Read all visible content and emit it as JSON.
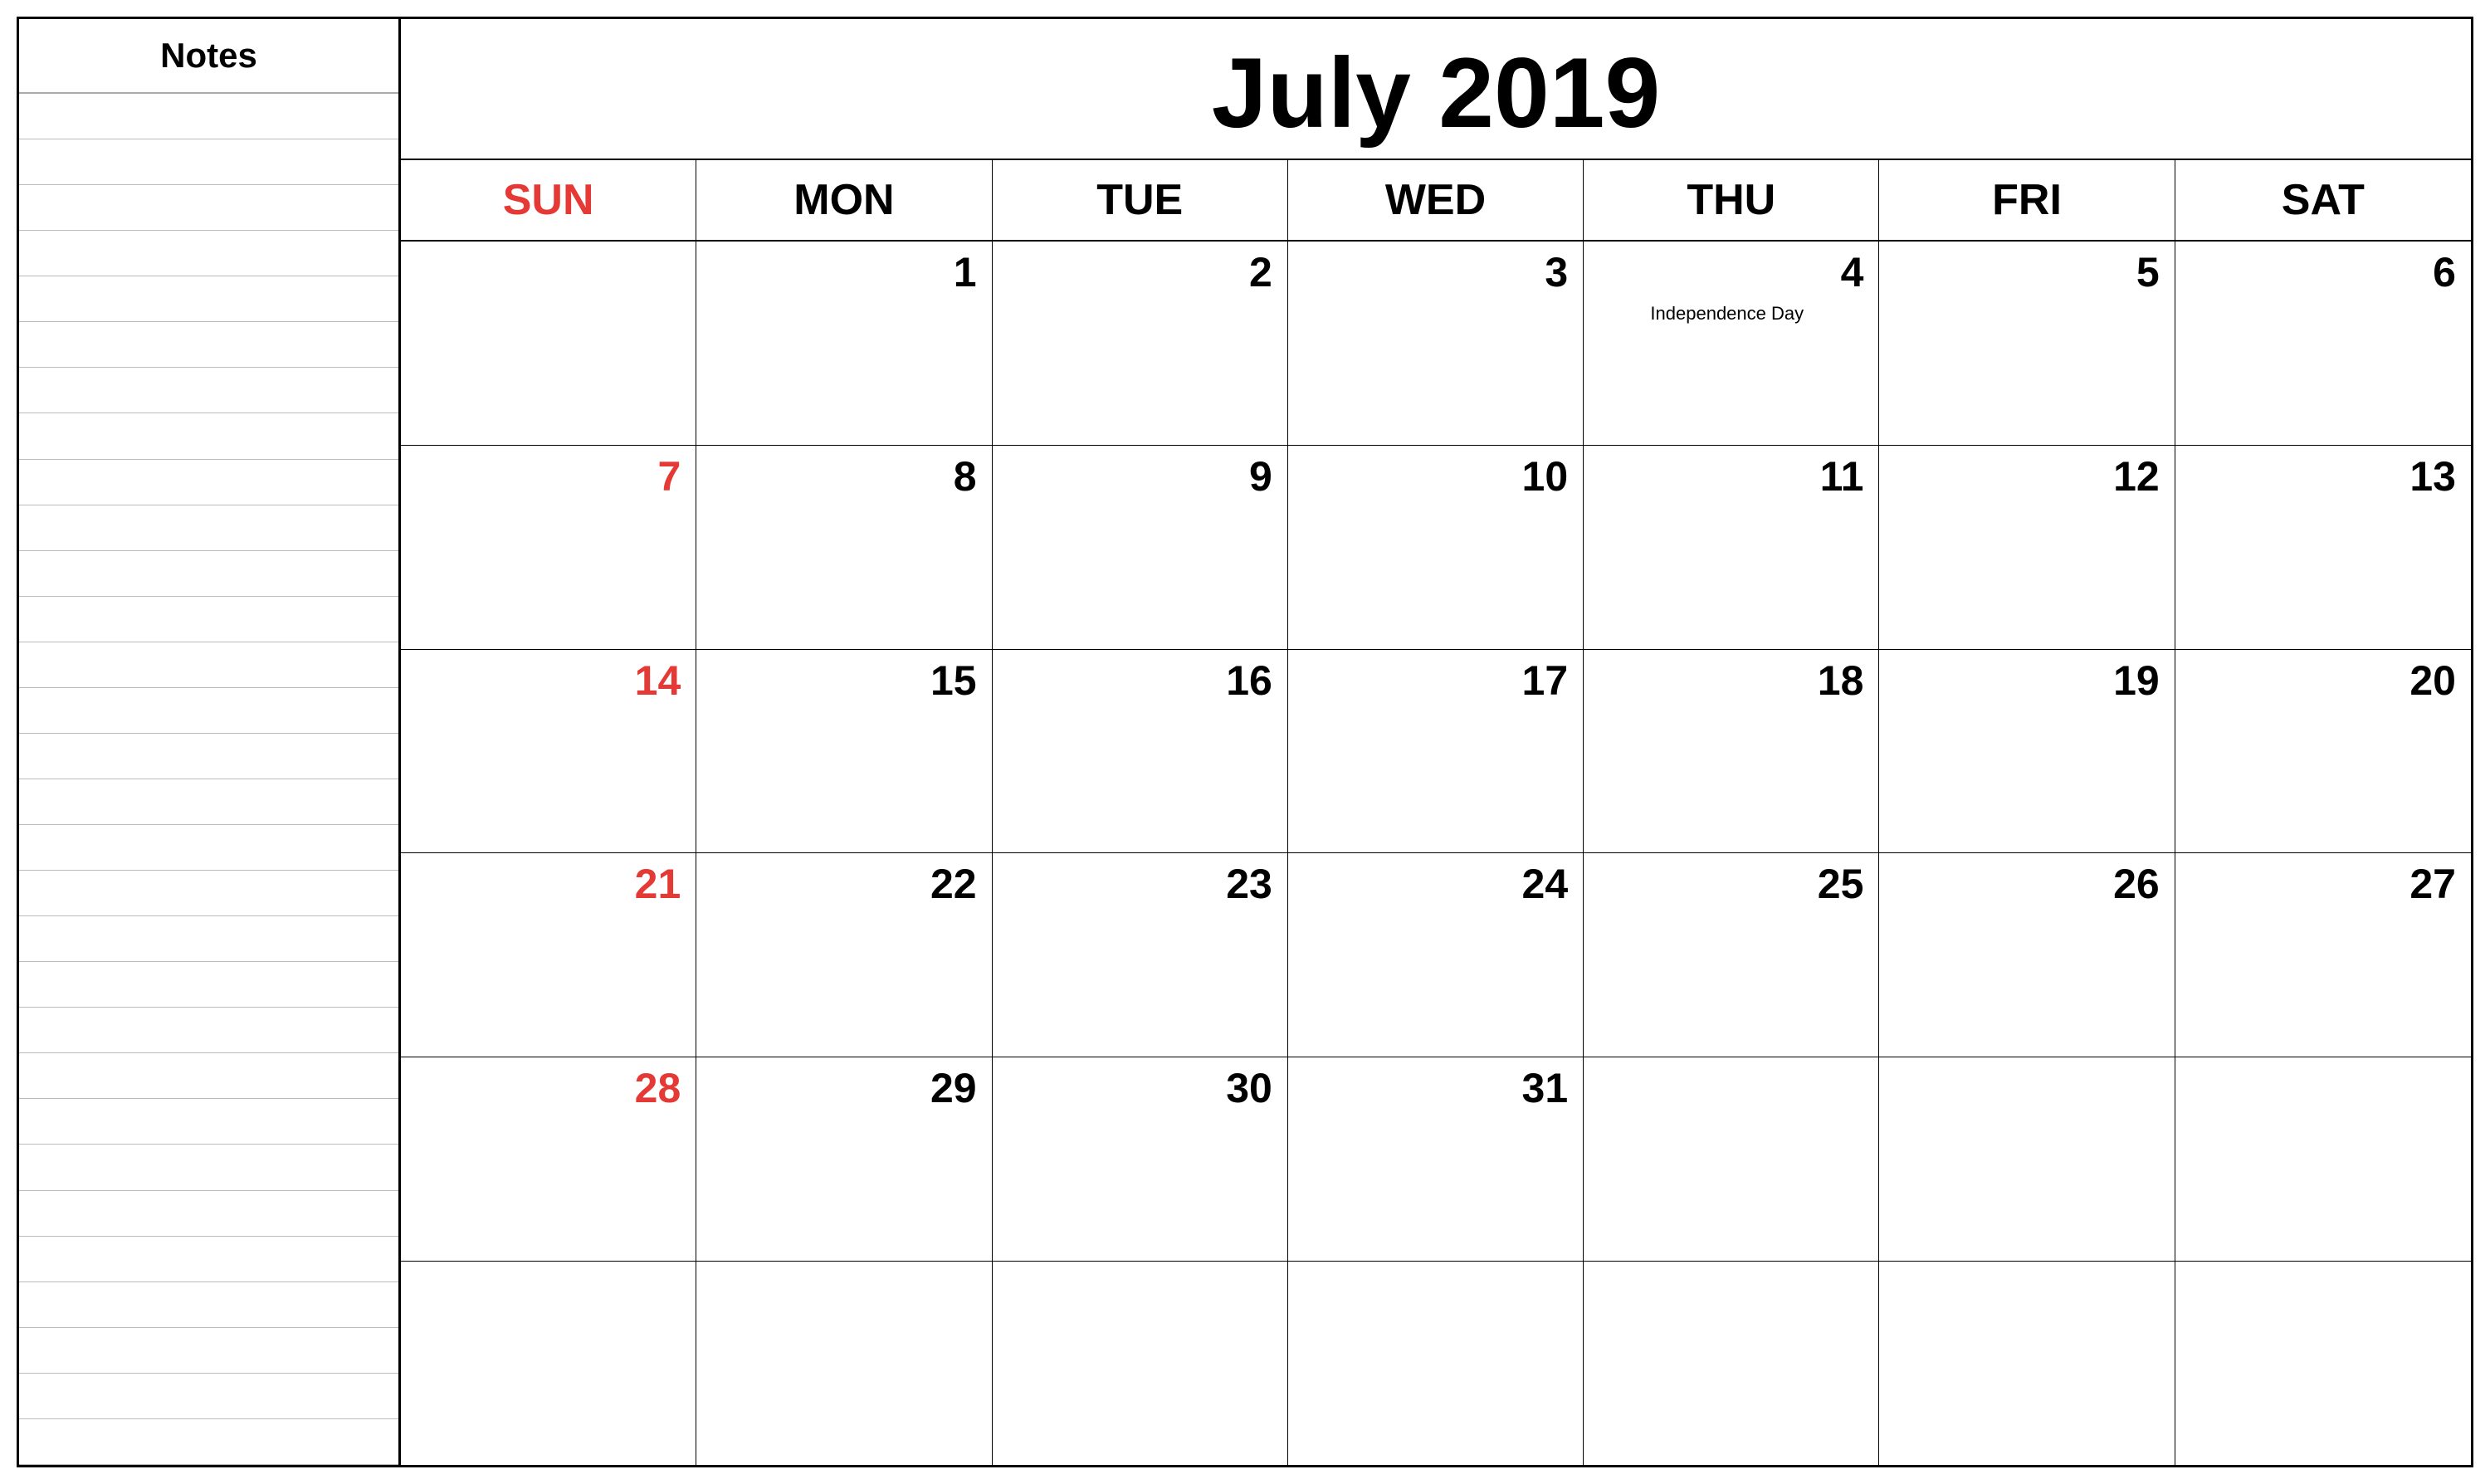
{
  "notes": {
    "header": "Notes",
    "line_count": 30
  },
  "calendar": {
    "title": "July 2019",
    "day_headers": [
      {
        "label": "SUN",
        "is_sunday": true
      },
      {
        "label": "MON",
        "is_sunday": false
      },
      {
        "label": "TUE",
        "is_sunday": false
      },
      {
        "label": "WED",
        "is_sunday": false
      },
      {
        "label": "THU",
        "is_sunday": false
      },
      {
        "label": "FRI",
        "is_sunday": false
      },
      {
        "label": "SAT",
        "is_sunday": false
      }
    ],
    "weeks": [
      [
        {
          "day": "",
          "empty": true,
          "sunday": false,
          "event": ""
        },
        {
          "day": "1",
          "empty": false,
          "sunday": false,
          "event": ""
        },
        {
          "day": "2",
          "empty": false,
          "sunday": false,
          "event": ""
        },
        {
          "day": "3",
          "empty": false,
          "sunday": false,
          "event": ""
        },
        {
          "day": "4",
          "empty": false,
          "sunday": false,
          "event": "Independence Day"
        },
        {
          "day": "5",
          "empty": false,
          "sunday": false,
          "event": ""
        },
        {
          "day": "6",
          "empty": false,
          "sunday": false,
          "event": ""
        }
      ],
      [
        {
          "day": "7",
          "empty": false,
          "sunday": true,
          "event": ""
        },
        {
          "day": "8",
          "empty": false,
          "sunday": false,
          "event": ""
        },
        {
          "day": "9",
          "empty": false,
          "sunday": false,
          "event": ""
        },
        {
          "day": "10",
          "empty": false,
          "sunday": false,
          "event": ""
        },
        {
          "day": "11",
          "empty": false,
          "sunday": false,
          "event": ""
        },
        {
          "day": "12",
          "empty": false,
          "sunday": false,
          "event": ""
        },
        {
          "day": "13",
          "empty": false,
          "sunday": false,
          "event": ""
        }
      ],
      [
        {
          "day": "14",
          "empty": false,
          "sunday": true,
          "event": ""
        },
        {
          "day": "15",
          "empty": false,
          "sunday": false,
          "event": ""
        },
        {
          "day": "16",
          "empty": false,
          "sunday": false,
          "event": ""
        },
        {
          "day": "17",
          "empty": false,
          "sunday": false,
          "event": ""
        },
        {
          "day": "18",
          "empty": false,
          "sunday": false,
          "event": ""
        },
        {
          "day": "19",
          "empty": false,
          "sunday": false,
          "event": ""
        },
        {
          "day": "20",
          "empty": false,
          "sunday": false,
          "event": ""
        }
      ],
      [
        {
          "day": "21",
          "empty": false,
          "sunday": true,
          "event": ""
        },
        {
          "day": "22",
          "empty": false,
          "sunday": false,
          "event": ""
        },
        {
          "day": "23",
          "empty": false,
          "sunday": false,
          "event": ""
        },
        {
          "day": "24",
          "empty": false,
          "sunday": false,
          "event": ""
        },
        {
          "day": "25",
          "empty": false,
          "sunday": false,
          "event": ""
        },
        {
          "day": "26",
          "empty": false,
          "sunday": false,
          "event": ""
        },
        {
          "day": "27",
          "empty": false,
          "sunday": false,
          "event": ""
        }
      ],
      [
        {
          "day": "28",
          "empty": false,
          "sunday": true,
          "event": ""
        },
        {
          "day": "29",
          "empty": false,
          "sunday": false,
          "event": ""
        },
        {
          "day": "30",
          "empty": false,
          "sunday": false,
          "event": ""
        },
        {
          "day": "31",
          "empty": false,
          "sunday": false,
          "event": ""
        },
        {
          "day": "",
          "empty": true,
          "sunday": false,
          "event": ""
        },
        {
          "day": "",
          "empty": true,
          "sunday": false,
          "event": ""
        },
        {
          "day": "",
          "empty": true,
          "sunday": false,
          "event": ""
        }
      ],
      [
        {
          "day": "",
          "empty": true,
          "sunday": false,
          "event": ""
        },
        {
          "day": "",
          "empty": true,
          "sunday": false,
          "event": ""
        },
        {
          "day": "",
          "empty": true,
          "sunday": false,
          "event": ""
        },
        {
          "day": "",
          "empty": true,
          "sunday": false,
          "event": ""
        },
        {
          "day": "",
          "empty": true,
          "sunday": false,
          "event": ""
        },
        {
          "day": "",
          "empty": true,
          "sunday": false,
          "event": ""
        },
        {
          "day": "",
          "empty": true,
          "sunday": false,
          "event": ""
        }
      ]
    ]
  }
}
